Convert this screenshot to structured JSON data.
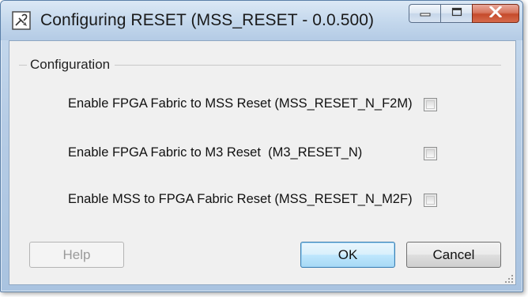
{
  "window": {
    "title": "Configuring RESET (MSS_RESET - 0.0.500)",
    "icon": "app-config-icon"
  },
  "caption_buttons": {
    "minimize": "minimize-icon",
    "maximize": "maximize-icon",
    "close": "close-icon"
  },
  "group": {
    "label": "Configuration"
  },
  "options": [
    {
      "label": "Enable FPGA Fabric to MSS Reset (MSS_RESET_N_F2M)",
      "checked": false
    },
    {
      "label": "Enable FPGA Fabric to M3 Reset  (M3_RESET_N)",
      "checked": false
    },
    {
      "label": "Enable MSS to FPGA Fabric Reset (MSS_RESET_N_M2F)",
      "checked": false
    }
  ],
  "buttons": {
    "help": "Help",
    "ok": "OK",
    "cancel": "Cancel"
  },
  "colors": {
    "close_button": "#c54b2c",
    "default_button_border": "#3c7fb1",
    "dialog_background": "#f0f0f0"
  }
}
